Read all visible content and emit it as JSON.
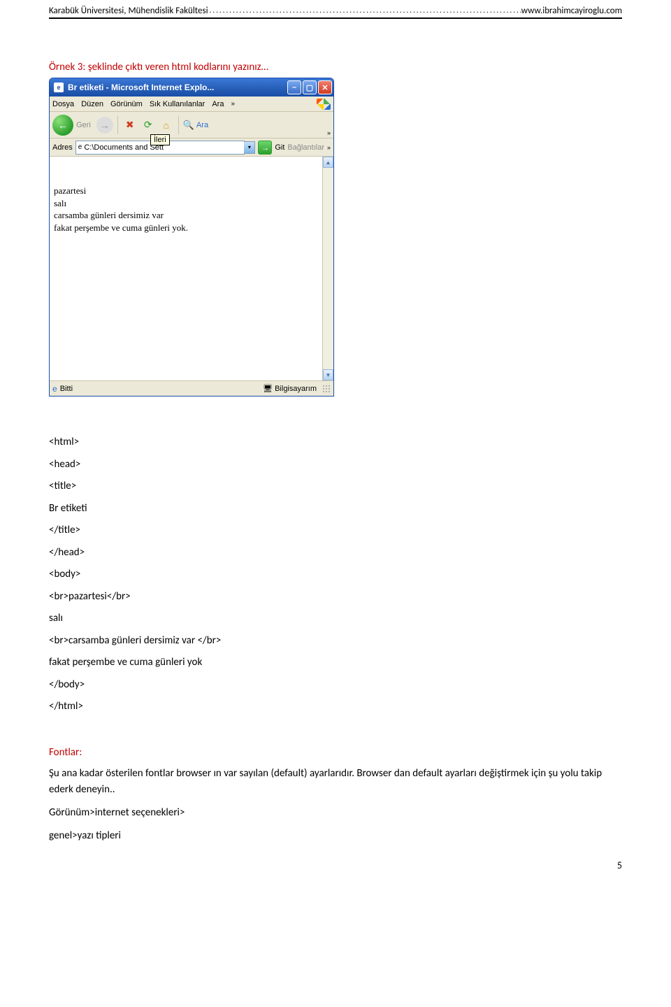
{
  "header": {
    "left": "Karabük Üniversitesi, Mühendislik Fakültesi",
    "dots": ".....................................................................................................................................................................",
    "right": "www.ibrahimcayiroglu.com"
  },
  "example_title": "Örnek 3: şeklinde çıktı veren html kodlarını yazınız…",
  "window": {
    "title": "Br etiketi - Microsoft Internet Explo...",
    "menus": [
      "Dosya",
      "Düzen",
      "Görünüm",
      "Sık Kullanılanlar",
      "Ara"
    ],
    "menu_chevron": "»",
    "nav": {
      "back_glyph": "←",
      "fwd_glyph": "→",
      "back_label": "Geri",
      "tooltip": "İleri",
      "search_label": "Ara"
    },
    "addr": {
      "label": "Adres",
      "value": "C:\\Documents and Sett",
      "go_label": "Git",
      "links_label": "Bağlantılar"
    },
    "content": {
      "line1": "pazartesi",
      "line2": "salı",
      "line3": "carsamba günleri dersimiz var",
      "line4": "fakat perşembe ve cuma günleri yok."
    },
    "status": {
      "done": "Bitti",
      "zone": "Bilgisayarım"
    },
    "glyphs": {
      "min": "–",
      "max": "▢",
      "close": "✕",
      "stop": "✖",
      "refresh": "⟳",
      "home": "⌂",
      "search": "🔍",
      "chev_right": "»",
      "dd": "▾",
      "up": "▲",
      "down": "▼",
      "ie": "e",
      "comp": "🖥",
      "go": "→"
    }
  },
  "code": {
    "l1": "<html>",
    "l2": "<head>",
    "l3": "<title>",
    "l4": " Br etiketi",
    "l5": "</title>",
    "l6": "</head>",
    "l7": "<body>",
    "l8": "<br>pazartesi</br>",
    "l9": "salı",
    "l10": "<br>carsamba günleri dersimiz var </br>",
    "l11": "fakat perşembe ve cuma günleri yok",
    "l12": "</body>",
    "l13": "</html>"
  },
  "fontlar": {
    "title": "Fontlar:",
    "para": "Şu ana kadar österilen fontlar browser ın var sayılan (default) ayarlarıdır. Browser dan default ayarları değiştirmek için şu yolu takip ederk deneyin..",
    "line2": " Görünüm>internet seçenekleri>",
    "line3": "genel>yazı tipleri"
  },
  "page_number": "5"
}
